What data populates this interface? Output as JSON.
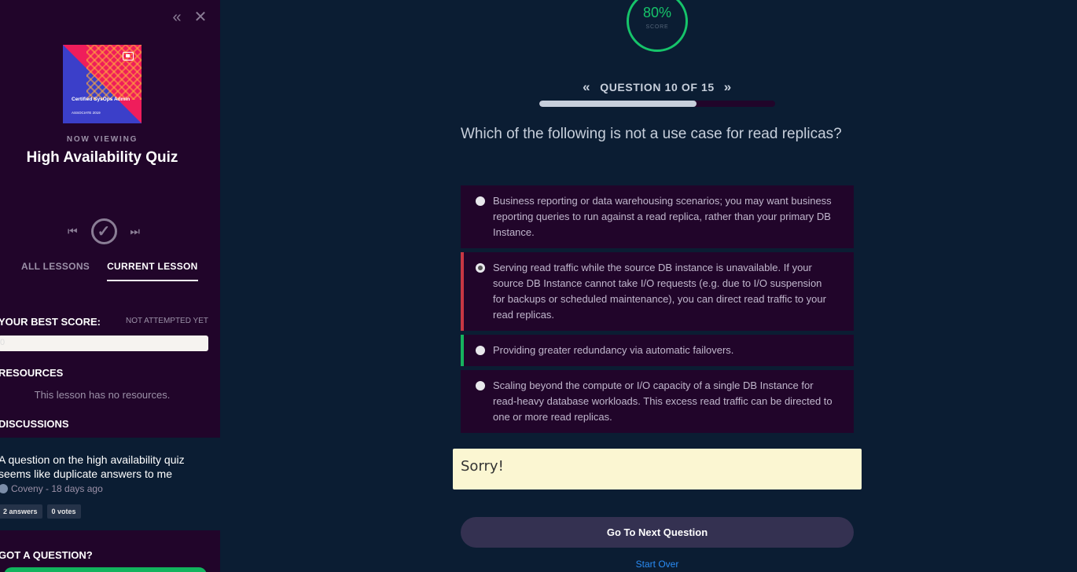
{
  "sidebar": {
    "thumbnail": {
      "title": "Certified SysOps Admin",
      "subtitle": "ASSOCIATE 2019"
    },
    "now_viewing": "NOW VIEWING",
    "lesson_title": "High Availability Quiz",
    "tabs": [
      {
        "label": "ALL LESSONS",
        "active": false
      },
      {
        "label": "CURRENT LESSON",
        "active": true
      }
    ],
    "best_score_label": "YOUR BEST SCORE:",
    "best_score_status": "NOT ATTEMPTED YET",
    "best_score_value": "0",
    "resources_label": "RESOURCES",
    "no_resources": "This lesson has no resources.",
    "discussions_label": "DISCUSSIONS",
    "discussion": {
      "question": "A question on the high availability quiz seems like duplicate answers to me",
      "author_meta": "Coveny - 18 days ago",
      "answers": "2 answers",
      "votes": "0 votes"
    },
    "got_question_label": "GOT A QUESTION?"
  },
  "quiz": {
    "score_percent": "80%",
    "score_label": "SCORE",
    "question_counter": "QUESTION 10 OF 15",
    "progress_fraction": 0.667,
    "question": "Which of the following is not a use case for read replicas?",
    "options": [
      {
        "text": "Business reporting or data warehousing scenarios; you may want business reporting queries to run against a read replica, rather than your primary DB Instance.",
        "state": "none"
      },
      {
        "text": "Serving read traffic while the source DB instance is unavailable. If your source DB Instance cannot take I/O requests (e.g. due to I/O suspension for backups or scheduled maintenance), you can direct read traffic to your read replicas.",
        "state": "wrong"
      },
      {
        "text": "Providing greater redundancy via automatic failovers.",
        "state": "correct"
      },
      {
        "text": "Scaling beyond the compute or I/O capacity of a single DB Instance for read-heavy database workloads. This excess read traffic can be directed to one or more read replicas.",
        "state": "none"
      }
    ],
    "feedback": "Sorry!",
    "next_button": "Go To Next Question",
    "start_over": "Start Over"
  },
  "colors": {
    "sidebar_bg": "#21052a",
    "main_bg": "#0b1d33",
    "accent_green": "#16c46a",
    "wrong_red": "#c73743",
    "link_blue": "#2a8cf5"
  }
}
